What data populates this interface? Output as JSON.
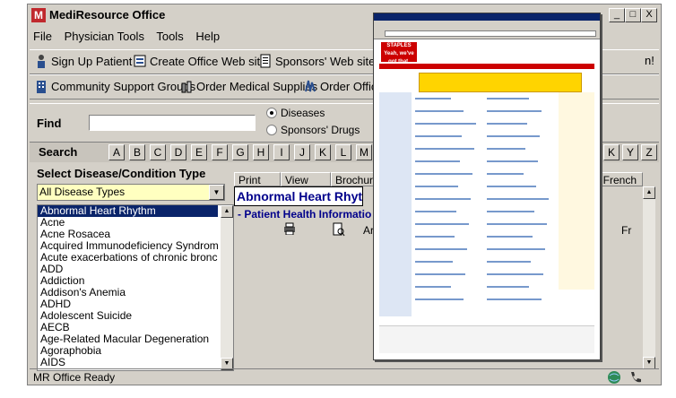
{
  "app": {
    "title": "MediResource Office",
    "icon_letter": "M"
  },
  "window_controls": {
    "minimize": "_",
    "maximize": "□",
    "close": "X"
  },
  "menu": [
    {
      "label": "File",
      "mnemonic": "F"
    },
    {
      "label": "Physician Tools",
      "mnemonic": "P"
    },
    {
      "label": "Tools",
      "mnemonic": "T"
    },
    {
      "label": "Help",
      "mnemonic": "H"
    }
  ],
  "toolbar1": [
    {
      "label": "Sign Up Patient",
      "icon": "person-icon"
    },
    {
      "label": "Create Office Web site",
      "icon": "webpage-icon"
    },
    {
      "label": "Sponsors' Web sites",
      "icon": "document-icon"
    }
  ],
  "toolbar2": [
    {
      "label": "Community Support Groups",
      "icon": "building-icon"
    },
    {
      "label": "Order Medical Supplies",
      "icon": "bottles-icon"
    },
    {
      "label": "Order Office",
      "icon": "supplies-icon"
    }
  ],
  "toolbar_overflow_text": "n!",
  "find": {
    "label": "Find",
    "value": "",
    "options": [
      {
        "label": "Diseases",
        "checked": true
      },
      {
        "label": "Sponsors' Drugs",
        "checked": false
      }
    ]
  },
  "search": {
    "label": "Search",
    "letters_left": [
      "A",
      "B",
      "C",
      "D",
      "E",
      "F",
      "G",
      "H",
      "I",
      "J",
      "K",
      "L",
      "M"
    ],
    "letters_right": [
      "K",
      "Y",
      "Z"
    ]
  },
  "disease_panel": {
    "label": "Select Disease/Condition Type",
    "type_selected": "All Disease Types",
    "items": [
      "Abnormal Heart Rhythm",
      "Acne",
      "Acne Rosacea",
      "Acquired Immunodeficiency Syndrome",
      "Acute exacerbations of chronic bronchitis",
      "ADD",
      "Addiction",
      "Addison's Anemia",
      "ADHD",
      "Adolescent Suicide",
      "AECB",
      "Age-Related Macular Degeneration",
      "Agoraphobia",
      "AIDS"
    ],
    "selected_index": 0
  },
  "grid": {
    "columns": [
      "Print",
      "View",
      "Brochure"
    ],
    "right_column": "t French",
    "title": "Abnormal Heart Rhythm",
    "subtitle": "- Patient Health Informatio",
    "row_text": "Arrhythm",
    "row_right_text": "Fr"
  },
  "status": {
    "text": "MR Office Ready"
  },
  "browser": {
    "site": "STAPLES",
    "tagline": "Yeah, we've got that."
  }
}
